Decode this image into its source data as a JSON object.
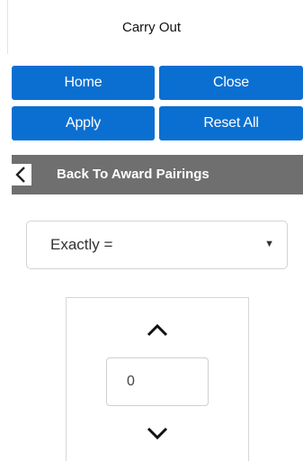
{
  "header": {
    "title": "Carry Out"
  },
  "buttons": {
    "home": "Home",
    "close": "Close",
    "apply": "Apply",
    "reset_all": "Reset All"
  },
  "back_bar": {
    "label": "Back To Award Pairings",
    "icon": "chevron-left-icon"
  },
  "filter": {
    "selected": "Exactly =",
    "icon": "caret-down-icon"
  },
  "stepper": {
    "value": "0",
    "up_icon": "chevron-up-icon",
    "down_icon": "chevron-down-icon"
  },
  "colors": {
    "button_blue": "#0b6fd1",
    "back_bar_gray": "#6f6f6f"
  }
}
